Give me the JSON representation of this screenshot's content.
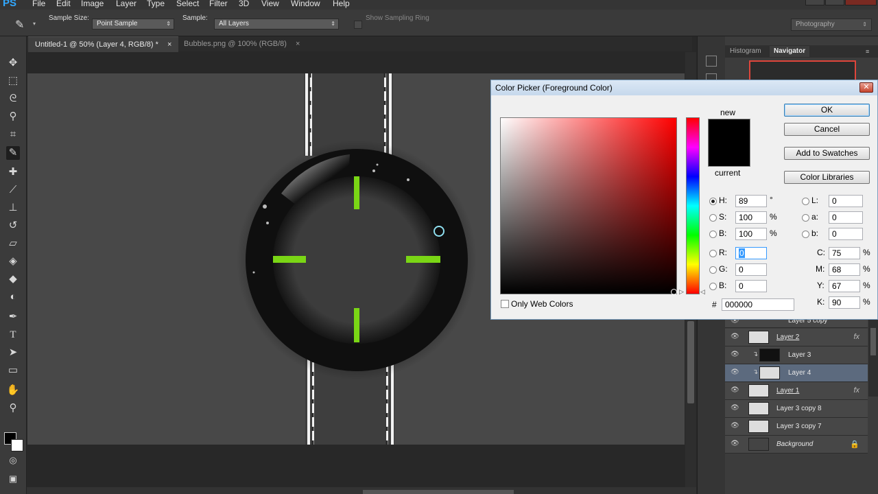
{
  "app": {
    "logo": "PS"
  },
  "menu": [
    "File",
    "Edit",
    "Image",
    "Layer",
    "Type",
    "Select",
    "Filter",
    "3D",
    "View",
    "Window",
    "Help"
  ],
  "options": {
    "sample_size_label": "Sample Size:",
    "sample_size_value": "Point Sample",
    "sample_label": "Sample:",
    "sample_value": "All Layers",
    "show_ring_label": "Show Sampling Ring",
    "workspace": "Photography"
  },
  "documents": [
    {
      "label": "Untitled-1 @ 50% (Layer 4, RGB/8) *",
      "active": true
    },
    {
      "label": "Bubbles.png @ 100% (RGB/8)",
      "active": false
    }
  ],
  "panels": {
    "tabs": [
      "Histogram",
      "Navigator"
    ]
  },
  "layers": [
    {
      "name": "Layer 5 copy",
      "fx": false,
      "clipped": true,
      "selected": false
    },
    {
      "name": "Layer 2",
      "fx": true,
      "clipped": false,
      "selected": false
    },
    {
      "name": "Layer 3",
      "fx": false,
      "clipped": true,
      "selected": false
    },
    {
      "name": "Layer 4",
      "fx": false,
      "clipped": true,
      "selected": true
    },
    {
      "name": "Layer 1",
      "fx": true,
      "clipped": false,
      "selected": false
    },
    {
      "name": "Layer 3 copy 8",
      "fx": false,
      "clipped": false,
      "selected": false
    },
    {
      "name": "Layer 3 copy 7",
      "fx": false,
      "clipped": false,
      "selected": false
    },
    {
      "name": "Background",
      "fx": false,
      "clipped": false,
      "selected": false,
      "locked": true
    }
  ],
  "color_picker": {
    "title": "Color Picker (Foreground Color)",
    "new_label": "new",
    "current_label": "current",
    "ok": "OK",
    "cancel": "Cancel",
    "add_swatches": "Add to Swatches",
    "color_libraries": "Color Libraries",
    "only_web_colors": "Only Web Colors",
    "H": "89",
    "S": "100",
    "B": "100",
    "R": "0",
    "G": "0",
    "Bv": "0",
    "L": "0",
    "a": "0",
    "b": "0",
    "C": "75",
    "M": "68",
    "Y": "67",
    "K": "90",
    "hex": "000000",
    "deg": "°",
    "pct": "%",
    "hash": "#",
    "labels": {
      "H": "H:",
      "S": "S:",
      "B": "B:",
      "R": "R:",
      "G": "G:",
      "Bv": "B:",
      "L": "L:",
      "a": "a:",
      "b": "b:",
      "C": "C:",
      "M": "M:",
      "Y": "Y:",
      "K": "K:"
    }
  },
  "colors": {
    "accent": "#31a8ff",
    "crosshair": "#7ad615",
    "hue_base": "#ff0000"
  }
}
